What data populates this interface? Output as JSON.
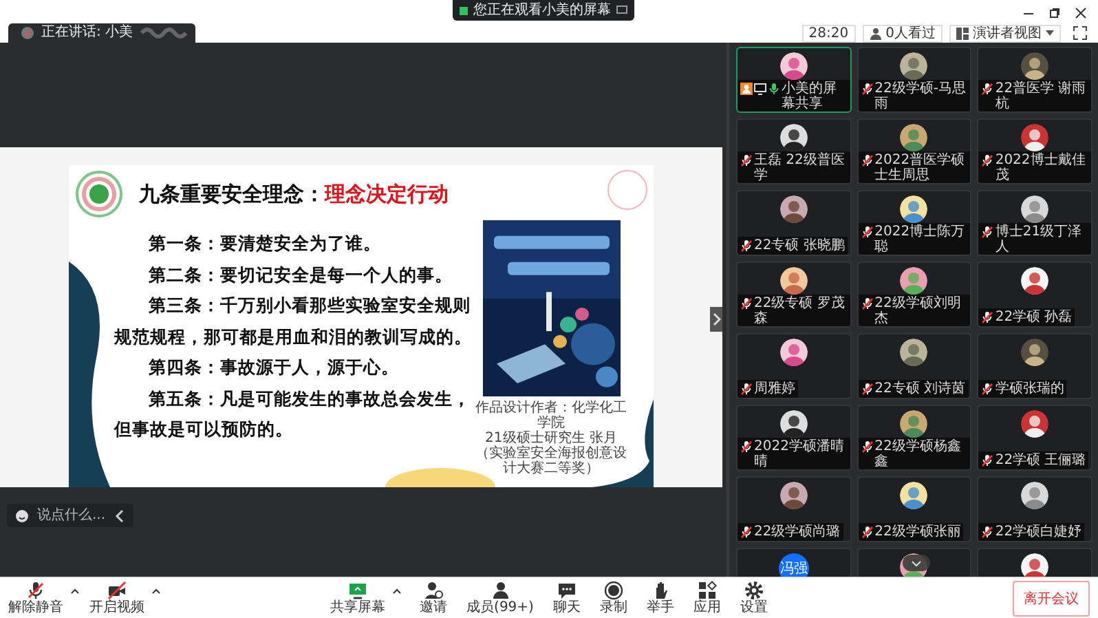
{
  "notice": {
    "text": "您正在观看小美的屏幕"
  },
  "speaker": {
    "label": "正在讲话: 小美"
  },
  "topbar": {
    "time": "28:20",
    "viewers": "0人看过",
    "view_mode": "演讲者视图"
  },
  "slide": {
    "title": "九条重要安全理念：",
    "title_highlight": "理念决定行动",
    "lines": [
      {
        "text": "第一条：要清楚安全为了谁。",
        "indent": true
      },
      {
        "text": "第二条：要切记安全是每一个人的事。",
        "indent": true
      },
      {
        "text": "第三条：千万别小看那些实验室安全规则",
        "indent": true
      },
      {
        "text": "规范规程，那可都是用血和泪的教训写成的。",
        "indent": false
      },
      {
        "text": "第四条：事故源于人，源于心。",
        "indent": true
      },
      {
        "text": "第五条：凡是可能发生的事故总会发生，",
        "indent": true
      },
      {
        "text": "但事故是可以预防的。",
        "indent": false
      }
    ],
    "caption": [
      "作品设计作者：化学化工学院",
      "21级硕士研究生 张月",
      "（实验室安全海报创意设计大赛二等奖）"
    ]
  },
  "chat": {
    "placeholder": "说点什么..."
  },
  "tiles": [
    {
      "name": "小美的屏幕共享",
      "muted": false,
      "sharing": true,
      "kind": "picture"
    },
    {
      "name": "22级学硕-马思雨",
      "muted": true,
      "sharing": false,
      "kind": "picture"
    },
    {
      "name": "22普医学 谢雨杭",
      "muted": true,
      "sharing": false,
      "kind": "picture"
    },
    {
      "name": "王磊 22级普医学",
      "muted": true,
      "sharing": false,
      "kind": "picture"
    },
    {
      "name": "2022普医学硕士生周思",
      "muted": true,
      "sharing": false,
      "kind": "picture"
    },
    {
      "name": "2022博士戴佳茂",
      "muted": true,
      "sharing": false,
      "kind": "picture"
    },
    {
      "name": "22专硕 张晓鹏",
      "muted": true,
      "sharing": false,
      "kind": "picture"
    },
    {
      "name": "2022博士陈万聪",
      "muted": true,
      "sharing": false,
      "kind": "picture"
    },
    {
      "name": "博士21级丁泽人",
      "muted": true,
      "sharing": false,
      "kind": "picture"
    },
    {
      "name": "22级专硕 罗茂森",
      "muted": true,
      "sharing": false,
      "kind": "picture"
    },
    {
      "name": "22级学硕刘明杰",
      "muted": true,
      "sharing": false,
      "kind": "picture"
    },
    {
      "name": "22学硕 孙磊",
      "muted": true,
      "sharing": false,
      "kind": "picture"
    },
    {
      "name": "周雅婷",
      "muted": true,
      "sharing": false,
      "kind": "picture"
    },
    {
      "name": "22专硕 刘诗茵",
      "muted": true,
      "sharing": false,
      "kind": "picture"
    },
    {
      "name": "学硕张瑞的",
      "muted": true,
      "sharing": false,
      "kind": "picture"
    },
    {
      "name": "2022学硕潘晴晴",
      "muted": true,
      "sharing": false,
      "kind": "picture"
    },
    {
      "name": "22级学硕杨鑫鑫",
      "muted": true,
      "sharing": false,
      "kind": "picture"
    },
    {
      "name": "22学硕 王俪璐",
      "muted": true,
      "sharing": false,
      "kind": "picture"
    },
    {
      "name": "22级学硕尚璐",
      "muted": true,
      "sharing": false,
      "kind": "picture"
    },
    {
      "name": "22级学硕张丽",
      "muted": true,
      "sharing": false,
      "kind": "picture"
    },
    {
      "name": "22学硕白婕妤",
      "muted": true,
      "sharing": false,
      "kind": "picture"
    },
    {
      "kind": "text",
      "avatar_text": "冯强"
    },
    {
      "kind": "picture"
    },
    {
      "kind": "picture"
    }
  ],
  "toolbar": {
    "left": [
      {
        "kind": "mic",
        "label": "解除静音",
        "off": true,
        "caret": true
      },
      {
        "kind": "camera",
        "label": "开启视频",
        "off": true,
        "caret": true
      }
    ],
    "center": [
      {
        "kind": "share",
        "label": "共享屏幕",
        "caret": true
      },
      {
        "kind": "invite",
        "label": "邀请",
        "caret": false
      },
      {
        "kind": "members",
        "label": "成员(99+)",
        "caret": false
      },
      {
        "kind": "chat",
        "label": "聊天",
        "caret": false
      },
      {
        "kind": "record",
        "label": "录制",
        "caret": false
      },
      {
        "kind": "hand",
        "label": "举手",
        "caret": false
      },
      {
        "kind": "apps",
        "label": "应用",
        "caret": false
      },
      {
        "kind": "settings",
        "label": "设置",
        "caret": false
      }
    ],
    "leave": "离开会议"
  }
}
